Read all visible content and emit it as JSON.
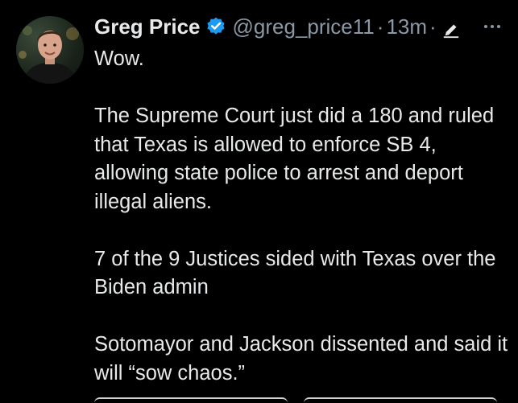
{
  "tweet": {
    "author": {
      "display_name": "Greg Price",
      "handle": "@greg_price11",
      "verified": true
    },
    "separator": "·",
    "timestamp": "13m",
    "edited": true,
    "paragraphs": [
      "Wow.",
      "The Supreme Court just did a 180 and ruled that Texas is allowed to enforce SB 4, allowing state police to arrest and deport illegal aliens.",
      "7 of the 9 Justices sided with Texas over the Biden admin",
      "Sotomayor and Jackson dissented and said it will “sow chaos.”"
    ]
  },
  "colors": {
    "background": "#000000",
    "text_primary": "#e7e9ea",
    "text_secondary": "#8b98a5",
    "verified_badge": "#1d9bf0"
  },
  "icons": {
    "verified": "verified-badge-icon",
    "edited": "pencil-icon",
    "more": "more-horizontal-icon"
  }
}
